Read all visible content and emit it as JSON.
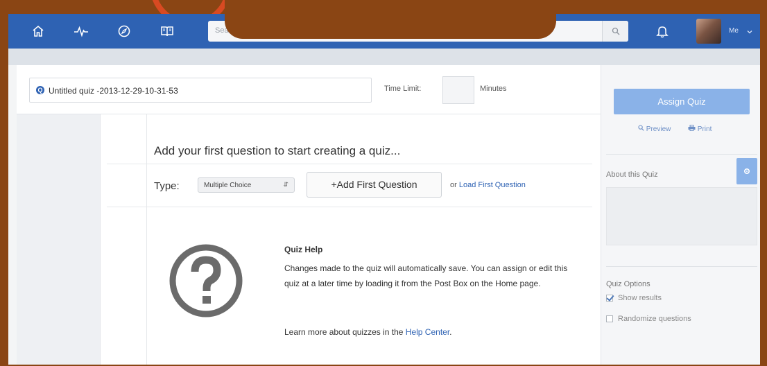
{
  "nav": {
    "search_placeholder": "Search",
    "user_label": "Me",
    "icons": [
      "home-icon",
      "activity-icon",
      "compass-icon",
      "book-icon",
      "search-icon",
      "bell-icon",
      "chevron-down-icon"
    ]
  },
  "quiz": {
    "title": "Untitled quiz -2013-12-29-10-31-53",
    "time_limit_label": "Time Limit:",
    "time_limit_value": "",
    "minutes_label": "Minutes"
  },
  "builder": {
    "heading": "Add your first question to start creating a quiz...",
    "type_label": "Type:",
    "type_selected": "Multiple Choice",
    "add_first_question_button": "+Add First Question",
    "or_text": "or",
    "load_first_question_link": "Load First Question"
  },
  "help": {
    "title": "Quiz Help",
    "body": "Changes made to the quiz will automatically save. You can assign or edit this quiz at a later time by loading it from the Post Box on the Home page.",
    "more_text": "Learn more about quizzes in the",
    "more_link": "Help Center",
    "more_suffix": "."
  },
  "sidebar": {
    "assign_button": "Assign Quiz",
    "preview_link": "Preview",
    "print_link": "Print",
    "about_label": "About this Quiz",
    "options_label": "Quiz Options",
    "options": [
      {
        "label": "Show results",
        "checked": true
      },
      {
        "label": "Randomize questions",
        "checked": false
      }
    ]
  },
  "colors": {
    "navbar": "#2e62b3",
    "accent_button": "#8ab2e8",
    "link": "#2e62b3",
    "background_border": "#8a4514",
    "annotation_circle": "#d84a22"
  }
}
